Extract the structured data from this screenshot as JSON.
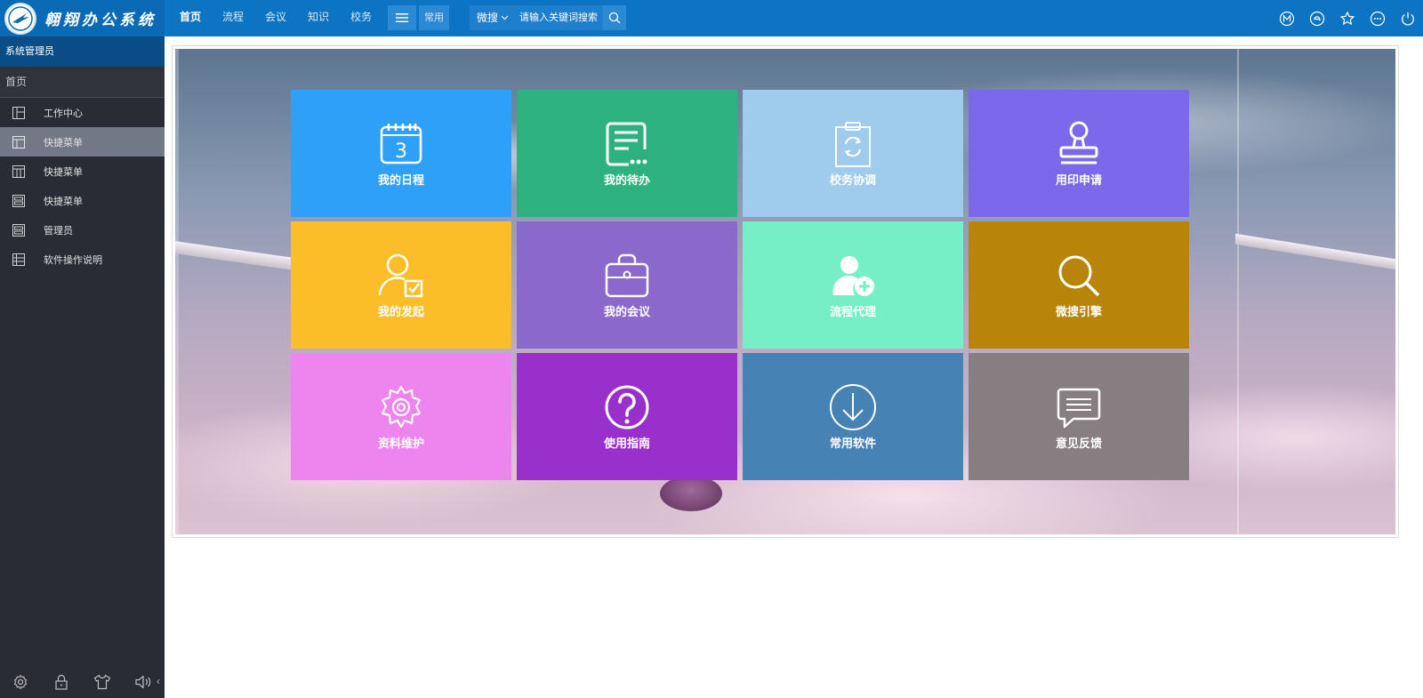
{
  "app": {
    "title": "翱翔办公系统"
  },
  "topnav": [
    "首页",
    "流程",
    "会议",
    "知识",
    "校务"
  ],
  "toolbar": {
    "common_label": "常用"
  },
  "search": {
    "scope": "微搜",
    "placeholder": "请输入关键词搜索"
  },
  "top_icons": [
    "m-circle-icon",
    "e-circle-icon",
    "star-icon",
    "more-icon",
    "power-icon"
  ],
  "sidebar": {
    "user": "系统管理员",
    "home": "首页",
    "items": [
      {
        "label": "工作中心",
        "icon": "layout-icon"
      },
      {
        "label": "快捷菜单",
        "icon": "window-icon",
        "active": true
      },
      {
        "label": "快捷菜单",
        "icon": "columns-icon"
      },
      {
        "label": "快捷菜单",
        "icon": "panel-icon"
      },
      {
        "label": "管理员",
        "icon": "panel-icon"
      },
      {
        "label": "软件操作说明",
        "icon": "table-icon"
      }
    ],
    "bottom_icons": [
      "settings-icon",
      "lock-icon",
      "shirt-icon",
      "speaker-icon"
    ]
  },
  "tiles": [
    {
      "label": "我的日程",
      "color": "#2ea0f8",
      "icon": "calendar-icon"
    },
    {
      "label": "我的待办",
      "color": "#2db17f",
      "icon": "document-icon"
    },
    {
      "label": "校务协调",
      "color": "#9fcbed",
      "icon": "clipboard-icon"
    },
    {
      "label": "用印申请",
      "color": "#7b68ea",
      "icon": "stamp-icon"
    },
    {
      "label": "我的发起",
      "color": "#fcbe28",
      "icon": "user-check-icon"
    },
    {
      "label": "我的会议",
      "color": "#8a68cc",
      "icon": "briefcase-icon"
    },
    {
      "label": "流程代理",
      "color": "#76efc6",
      "icon": "user-add-icon"
    },
    {
      "label": "微搜引擎",
      "color": "#b8850a",
      "icon": "search-icon"
    },
    {
      "label": "资料维护",
      "color": "#ee85ee",
      "icon": "gear-icon"
    },
    {
      "label": "使用指南",
      "color": "#9930cc",
      "icon": "help-icon"
    },
    {
      "label": "常用软件",
      "color": "#4682b4",
      "icon": "download-icon"
    },
    {
      "label": "意见反馈",
      "color": "#867e80",
      "icon": "comment-icon"
    }
  ],
  "colors": {
    "topbar": "#0d74c4",
    "sidebar": "#2a2c34",
    "user_bar": "#0a4c86",
    "active_item": "#737886"
  }
}
